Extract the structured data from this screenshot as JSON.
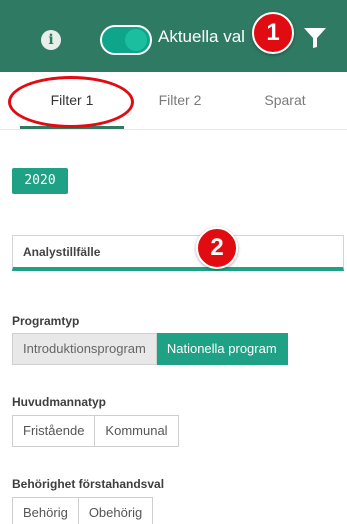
{
  "header": {
    "toggle_label": "Aktuella val",
    "badge_1": "1",
    "toggle_on": true
  },
  "tabs": [
    {
      "label": "Filter 1",
      "active": true
    },
    {
      "label": "Filter 2",
      "active": false
    },
    {
      "label": "Sparat",
      "active": false
    }
  ],
  "year_chip": "2020",
  "analys": {
    "label": "Analystillfälle",
    "badge_2": "2"
  },
  "programtyp": {
    "title": "Programtyp",
    "options": [
      {
        "label": "Introduktionsprogram",
        "state": "excluded"
      },
      {
        "label": "Nationella program",
        "state": "selected"
      }
    ]
  },
  "huvudmannatyp": {
    "title": "Huvudmannatyp",
    "options": [
      {
        "label": "Fristående",
        "state": "possible"
      },
      {
        "label": "Kommunal",
        "state": "possible"
      }
    ]
  },
  "behorighet": {
    "title": "Behörighet förstahandsval",
    "options": [
      {
        "label": "Behörig",
        "state": "possible"
      },
      {
        "label": "Obehörig",
        "state": "possible"
      }
    ]
  },
  "colors": {
    "header_bg": "#2f7a62",
    "accent": "#1fa186",
    "badge_red": "#e10c12"
  },
  "icons": [
    "info-icon",
    "filter-icon"
  ]
}
